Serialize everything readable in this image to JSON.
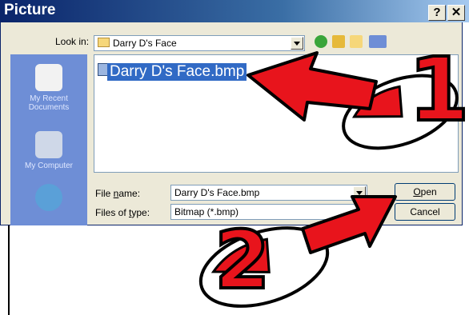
{
  "window": {
    "title": "Picture",
    "help_glyph": "?",
    "close_glyph": "✕"
  },
  "lookin": {
    "label": "Look in:",
    "value": "Darry D's Face"
  },
  "places": [
    {
      "label": "My Recent Documents",
      "icon": "recent-documents-icon"
    },
    {
      "label": "My Computer",
      "icon": "my-computer-icon"
    },
    {
      "label": "",
      "icon": "network-icon"
    }
  ],
  "files": [
    {
      "name": "Darry D's Face.bmp",
      "selected": true
    }
  ],
  "filename": {
    "label": "File name:",
    "value": "Darry D's Face.bmp"
  },
  "filetype": {
    "label": "Files of type:",
    "value": "Bitmap (*.bmp)"
  },
  "buttons": {
    "open": "Open",
    "cancel": "Cancel"
  },
  "annotations": {
    "step1": "1",
    "step2": "2"
  },
  "colors": {
    "arrow": "#e8141c",
    "selection": "#316ac5",
    "titlebar": "#0a246a"
  }
}
